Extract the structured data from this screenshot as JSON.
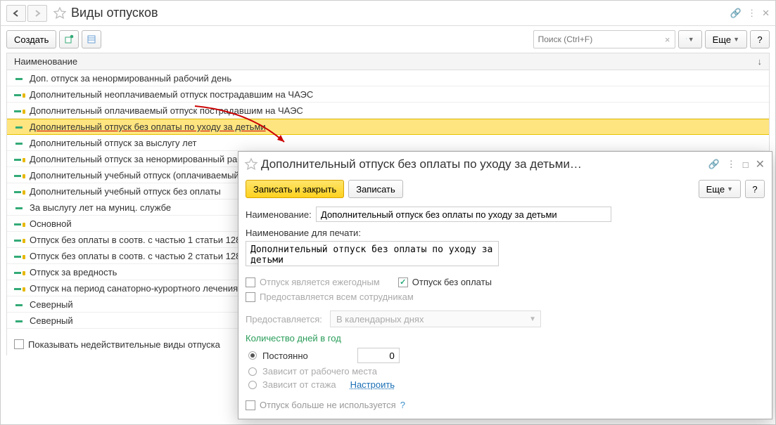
{
  "page_title": "Виды отпусков",
  "toolbar": {
    "create_label": "Создать",
    "more_label": "Еще"
  },
  "search": {
    "placeholder": "Поиск (Ctrl+F)"
  },
  "list_header": "Наименование",
  "rows": [
    {
      "text": "Доп. отпуск за ненормированный рабочий день",
      "locked": false,
      "selected": false
    },
    {
      "text": "Дополнительный неоплачиваемый отпуск пострадавшим на ЧАЭС",
      "locked": true,
      "selected": false
    },
    {
      "text": "Дополнительный оплачиваемый отпуск пострадавшим на ЧАЭС",
      "locked": true,
      "selected": false
    },
    {
      "text": "Дополнительный отпуск без оплаты по уходу за детьми",
      "locked": false,
      "selected": true
    },
    {
      "text": "Дополнительный отпуск за выслугу лет",
      "locked": false,
      "selected": false
    },
    {
      "text": "Дополнительный отпуск за ненормированный рабочий день",
      "locked": true,
      "selected": false
    },
    {
      "text": "Дополнительный учебный отпуск (оплачиваемый)",
      "locked": true,
      "selected": false
    },
    {
      "text": "Дополнительный учебный отпуск без оплаты",
      "locked": true,
      "selected": false
    },
    {
      "text": "За выслугу лет на муниц. службе",
      "locked": false,
      "selected": false
    },
    {
      "text": "Основной",
      "locked": true,
      "selected": false
    },
    {
      "text": "Отпуск без оплаты в соотв. с частью 1 статьи 128 ТК РФ",
      "locked": true,
      "selected": false
    },
    {
      "text": "Отпуск без оплаты в соотв. с частью 2 статьи 128 ТК РФ",
      "locked": true,
      "selected": false
    },
    {
      "text": "Отпуск за вредность",
      "locked": true,
      "selected": false
    },
    {
      "text": "Отпуск на период санаторно-курортного лечения",
      "locked": true,
      "selected": false
    },
    {
      "text": "Северный",
      "locked": false,
      "selected": false
    },
    {
      "text": "Северный",
      "locked": false,
      "selected": false
    }
  ],
  "show_inactive_label": "Показывать недействительные виды отпуска",
  "dialog": {
    "title": "Дополнительный отпуск без оплаты по уходу за детьми…",
    "save_close_label": "Записать и закрыть",
    "save_label": "Записать",
    "more_label": "Еще",
    "name_label": "Наименование:",
    "name_value": "Дополнительный отпуск без оплаты по уходу за детьми",
    "print_name_label": "Наименование для печати:",
    "print_name_value": "Дополнительный отпуск без оплаты по уходу за детьми",
    "annual_label": "Отпуск является ежегодным",
    "unpaid_label": "Отпуск без оплаты",
    "all_employees_label": "Предоставляется всем сотрудникам",
    "grant_label": "Предоставляется:",
    "grant_value": "В календарных днях",
    "days_per_year_label": "Количество дней в год",
    "radio_constant": "Постоянно",
    "days_value": "0",
    "radio_workplace": "Зависит от рабочего места",
    "radio_tenure": "Зависит от стажа",
    "configure_link": "Настроить",
    "not_used_label": "Отпуск больше не используется"
  }
}
